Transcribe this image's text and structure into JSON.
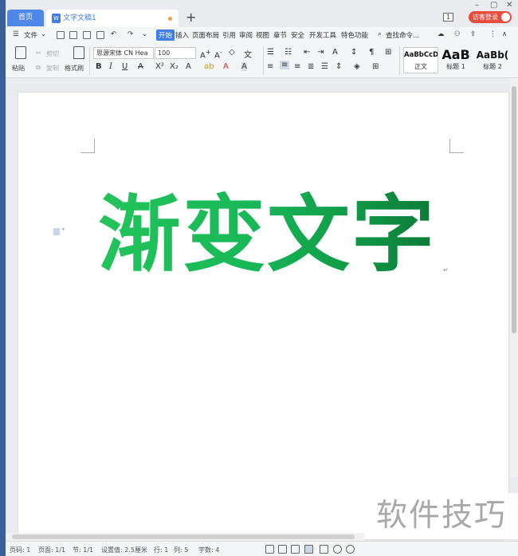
{
  "tabs": {
    "home": "首页",
    "document": "文字文稿1",
    "new_tab": "+"
  },
  "titlebar": {
    "badge": "1",
    "login": "访客登录",
    "minimize": "–",
    "maximize": "▢",
    "close": "✕"
  },
  "menu": {
    "file": "文件",
    "items": [
      "开始",
      "插入",
      "页面布局",
      "引用",
      "审阅",
      "视图",
      "章节",
      "安全",
      "开发工具",
      "特色功能"
    ],
    "search": "查找命令..."
  },
  "ribbon": {
    "paste": "粘贴",
    "cut": "剪切",
    "copy": "复制",
    "format_painter": "格式刷",
    "font_name": "思源宋体 CN Hea",
    "font_size": "100",
    "bold": "B",
    "italic": "I",
    "underline": "U",
    "styles": [
      {
        "sample": "AaBbCcDd",
        "name": "正文"
      },
      {
        "sample": "AaB",
        "name": "标题 1"
      },
      {
        "sample": "AaBb(",
        "name": "标题 2"
      }
    ]
  },
  "document": {
    "content": "渐变文字",
    "gradient_colors": [
      "#22c45a",
      "#0b7a38"
    ]
  },
  "statusbar": {
    "page_number": "页码: 1",
    "pages": "页面: 1/1",
    "section": "节: 1/1",
    "setting": "设置值: 2.5厘米",
    "line": "行: 1",
    "column": "列: 5",
    "word_count": "字数: 4"
  },
  "watermark": "软件技巧"
}
